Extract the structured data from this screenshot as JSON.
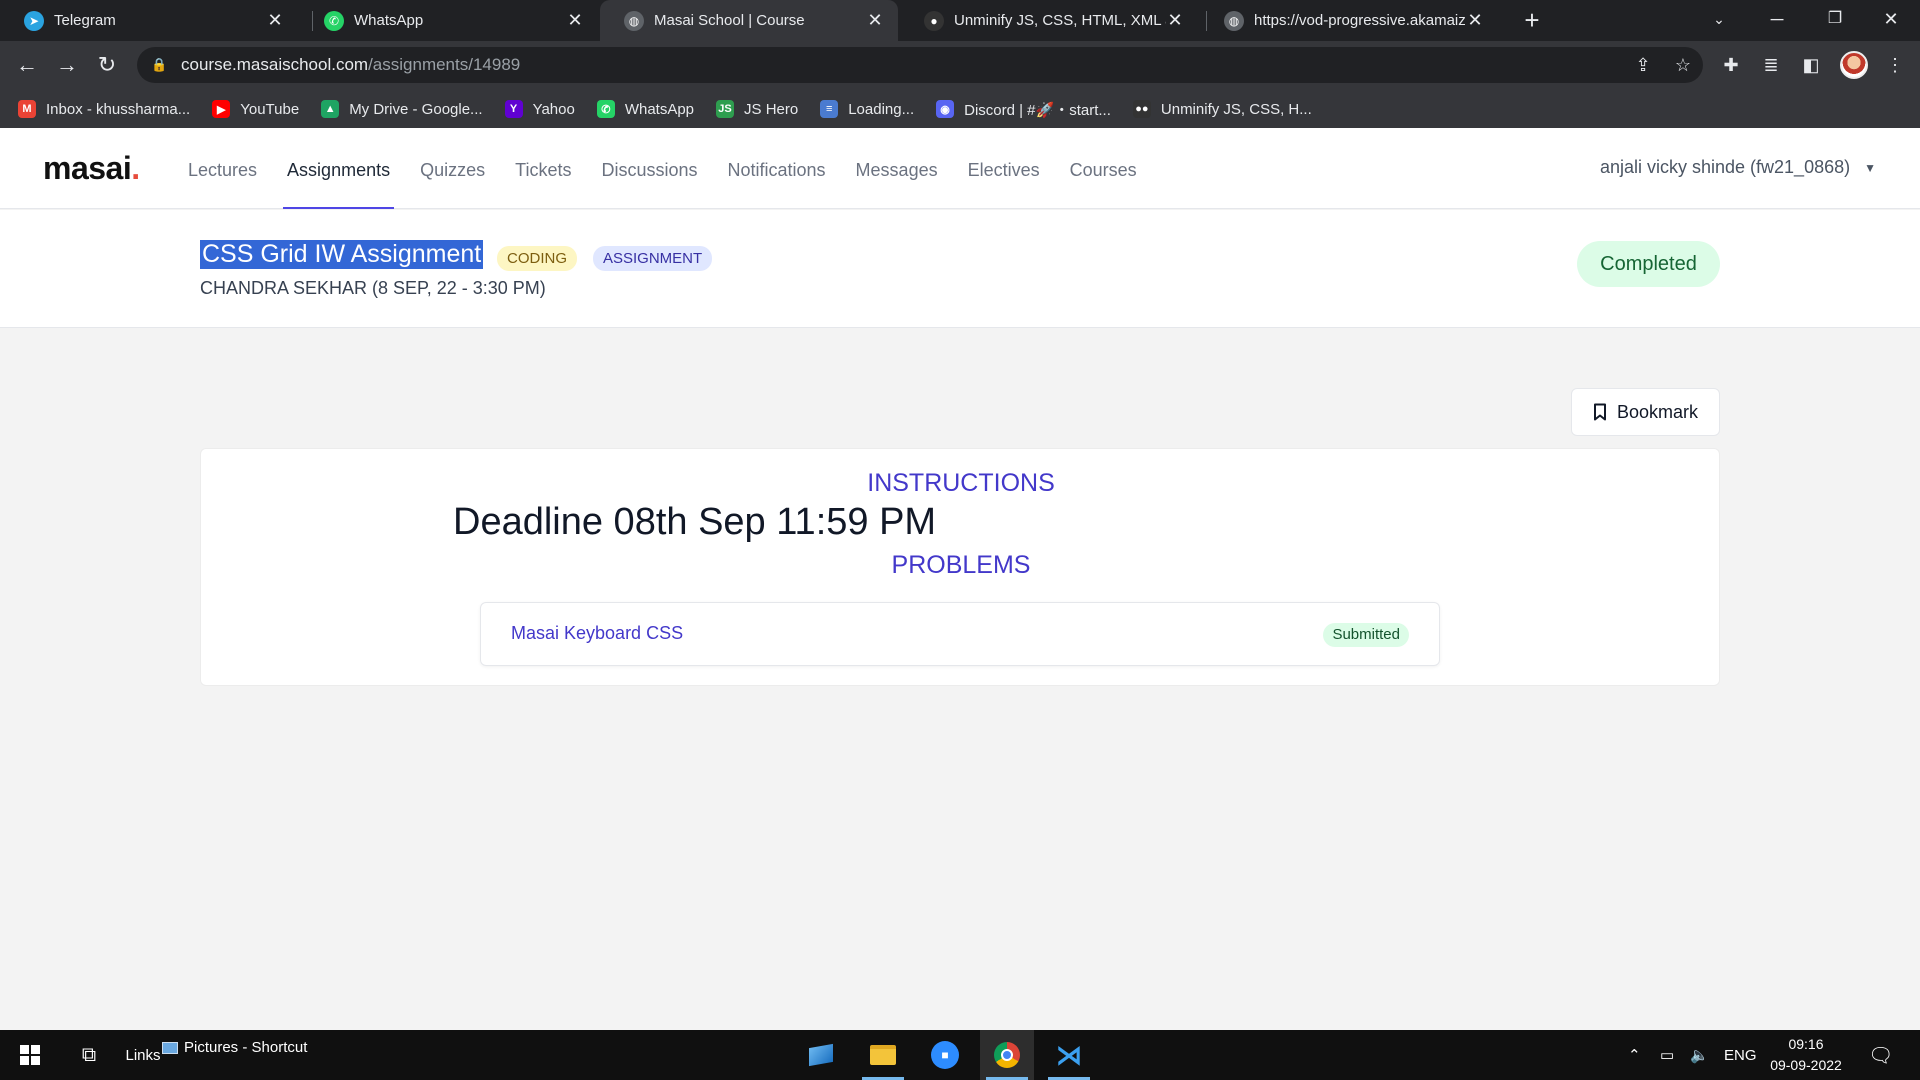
{
  "browser": {
    "tabs": [
      {
        "title": "Telegram",
        "icon": "telegram-icon",
        "color": "#2aa3e0"
      },
      {
        "title": "WhatsApp",
        "icon": "whatsapp-icon",
        "color": "#25d366"
      },
      {
        "title": "Masai School | Course",
        "icon": "globe-icon",
        "color": "#9aa0a6"
      },
      {
        "title": "Unminify JS, CSS, HTML, XML and",
        "icon": "unminify-icon",
        "color": "#333333"
      },
      {
        "title": "https://vod-progressive.akamaize",
        "icon": "globe-icon",
        "color": "#9aa0a6"
      }
    ],
    "address": {
      "domain": "course.masaischool.com",
      "path": "/assignments/14989"
    },
    "bookmarks": [
      {
        "label": "Inbox - khussharma...",
        "icon": "gmail-icon",
        "color": "#ea4335",
        "glyph": "M"
      },
      {
        "label": "YouTube",
        "icon": "youtube-icon",
        "color": "#ff0000",
        "glyph": "▶"
      },
      {
        "label": "My Drive - Google...",
        "icon": "drive-icon",
        "color": "#1fa463",
        "glyph": "▲"
      },
      {
        "label": "Yahoo",
        "icon": "yahoo-icon",
        "color": "#6001d2",
        "glyph": "Y"
      },
      {
        "label": "WhatsApp",
        "icon": "whatsapp-icon",
        "color": "#25d366",
        "glyph": "✆"
      },
      {
        "label": "JS Hero",
        "icon": "jshero-icon",
        "color": "#2e9e4f",
        "glyph": "JS"
      },
      {
        "label": "Loading...",
        "icon": "loading-icon",
        "color": "#4a7bd0",
        "glyph": "≡"
      },
      {
        "label": "Discord | #🚀・start...",
        "icon": "discord-icon",
        "color": "#5865f2",
        "glyph": "◉"
      },
      {
        "label": "Unminify JS, CSS, H...",
        "icon": "unminify-icon",
        "color": "#333333",
        "glyph": "●●"
      }
    ]
  },
  "site": {
    "logo": "masai",
    "logo_dot": ".",
    "nav": [
      "Lectures",
      "Assignments",
      "Quizzes",
      "Tickets",
      "Discussions",
      "Notifications",
      "Messages",
      "Electives",
      "Courses"
    ],
    "active_nav": "Assignments",
    "user": "anjali vicky shinde (fw21_0868)"
  },
  "assignment": {
    "title": "CSS Grid IW Assignment",
    "tags": [
      "CODING",
      "ASSIGNMENT"
    ],
    "meta": "CHANDRA SEKHAR (8 SEP, 22 - 3:30 PM)",
    "status": "Completed",
    "bookmark_label": "Bookmark",
    "instructions_heading": "INSTRUCTIONS",
    "deadline": "Deadline 08th Sep 11:59 PM",
    "problems_heading": "PROBLEMS",
    "problems": [
      {
        "name": "Masai Keyboard CSS",
        "status": "Submitted"
      }
    ]
  },
  "taskbar": {
    "links_label": "Links",
    "pictures_label": "Pictures - Shortcut",
    "language": "ENG",
    "time": "09:16",
    "date": "09-09-2022"
  }
}
